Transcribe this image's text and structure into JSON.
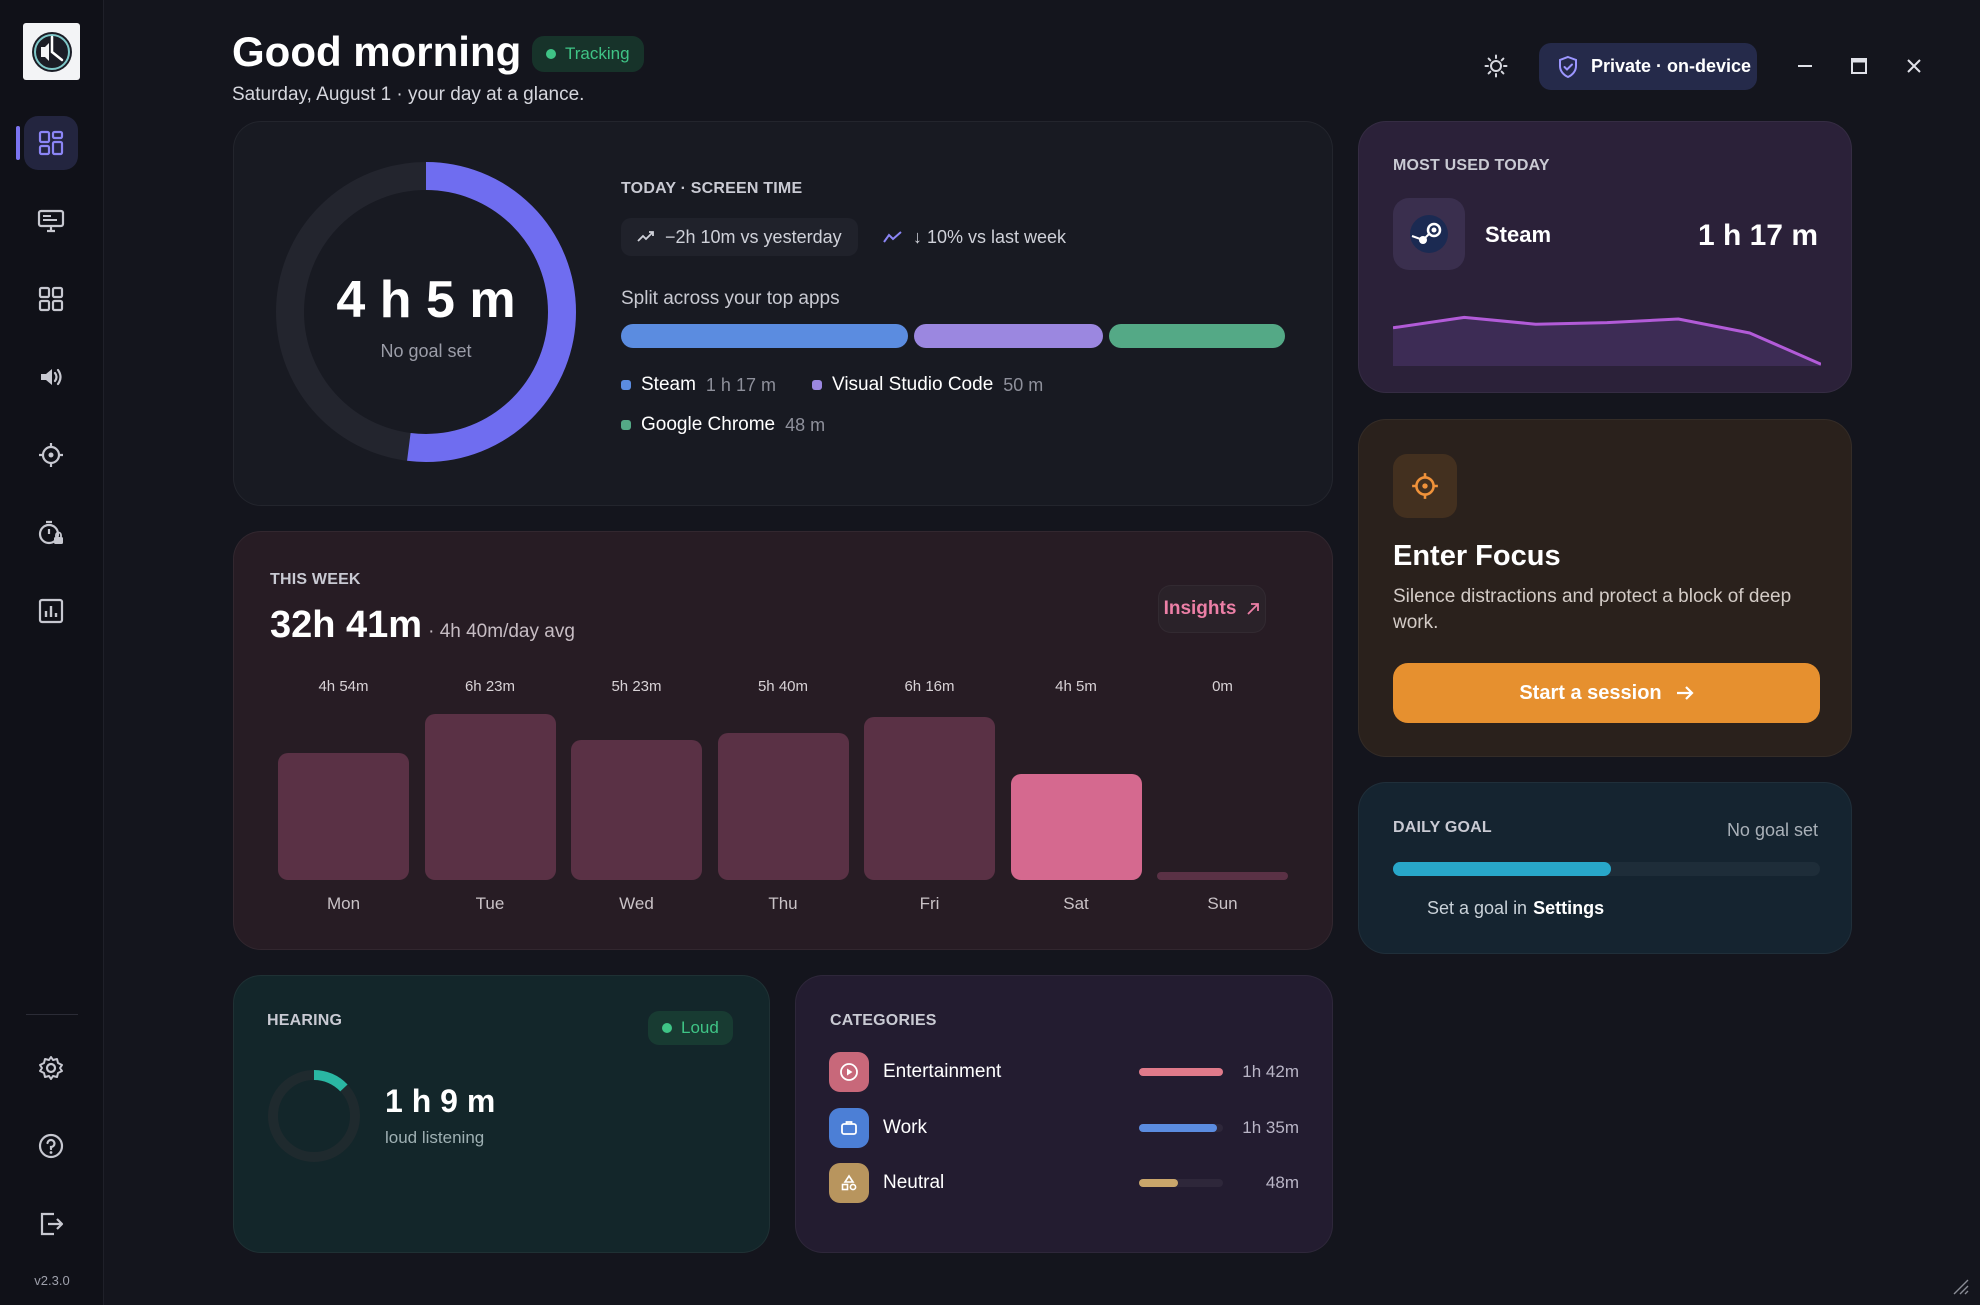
{
  "header": {
    "greeting": "Good morning",
    "tracking_label": "Tracking",
    "subtitle": "Saturday, August 1 · your day at a glance.",
    "privacy_label": "Private · on-device"
  },
  "sidebar": {
    "items": [
      {
        "name": "dashboard",
        "icon": "dashboard-icon",
        "active": true
      },
      {
        "name": "screen-time",
        "icon": "monitor-icon"
      },
      {
        "name": "apps",
        "icon": "apps-grid-icon"
      },
      {
        "name": "hearing",
        "icon": "speaker-icon"
      },
      {
        "name": "focus",
        "icon": "crosshair-icon"
      },
      {
        "name": "limits",
        "icon": "timer-lock-icon"
      },
      {
        "name": "reports",
        "icon": "bar-chart-icon"
      }
    ],
    "bottom_items": [
      {
        "name": "settings",
        "icon": "gear-icon"
      },
      {
        "name": "help",
        "icon": "help-icon"
      },
      {
        "name": "logout",
        "icon": "logout-icon"
      }
    ],
    "version": "v2.3.0"
  },
  "today": {
    "total": "4 h 5 m",
    "goal_text": "No goal set",
    "ring_progress": 0.52,
    "label": "TODAY · SCREEN TIME",
    "vs_yesterday": "−2h 10m vs yesterday",
    "vs_last_week": "↓ 10% vs last week",
    "split_title": "Split across your top apps",
    "apps": [
      {
        "name": "Steam",
        "time": "1 h 17 m",
        "color": "#5b8ce0",
        "share": 0.44
      },
      {
        "name": "Visual Studio Code",
        "time": "50 m",
        "color": "#9b87e0",
        "share": 0.29
      },
      {
        "name": "Google Chrome",
        "time": "48 m",
        "color": "#54a986",
        "share": 0.27
      }
    ]
  },
  "week": {
    "label": "THIS WEEK",
    "total": "32h 41m",
    "avg": "· 4h 40m/day avg",
    "insights_label": "Insights",
    "chart_data": {
      "type": "bar",
      "categories": [
        "Mon",
        "Tue",
        "Wed",
        "Thu",
        "Fri",
        "Sat",
        "Sun"
      ],
      "value_labels": [
        "4h 54m",
        "6h 23m",
        "5h 23m",
        "5h 40m",
        "6h 16m",
        "4h 5m",
        "0m"
      ],
      "values": [
        294,
        383,
        323,
        340,
        376,
        245,
        0
      ],
      "highlight_index": 5
    }
  },
  "most_used": {
    "label": "MOST USED TODAY",
    "app": "Steam",
    "time": "1 h 17 m",
    "sparkline": [
      0.35,
      0.55,
      0.42,
      0.45,
      0.52,
      0.25,
      -0.35
    ]
  },
  "focus": {
    "title": "Enter Focus",
    "description": "Silence distractions and protect a block of deep work.",
    "button_label": "Start a session"
  },
  "daily_goal": {
    "label": "DAILY GOAL",
    "status": "No goal set",
    "progress": 0.51,
    "hint_prefix": "Set a goal in",
    "hint_link": "Settings"
  },
  "hearing": {
    "label": "HEARING",
    "badge": "Loud",
    "value": "1 h 9 m",
    "caption": "loud listening",
    "ring_progress": 0.13
  },
  "categories": {
    "label": "CATEGORIES",
    "items": [
      {
        "name": "Entertainment",
        "time": "1h 42m",
        "color": "#e07a8a",
        "fraction": 1.0,
        "icon": "play-icon"
      },
      {
        "name": "Work",
        "time": "1h 35m",
        "color": "#5b8ce0",
        "fraction": 0.93,
        "icon": "briefcase-icon"
      },
      {
        "name": "Neutral",
        "time": "48m",
        "color": "#c9a66b",
        "fraction": 0.47,
        "icon": "shapes-icon"
      }
    ]
  }
}
